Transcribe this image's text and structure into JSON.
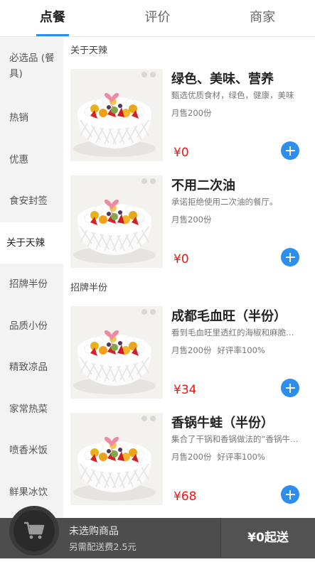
{
  "tabs": [
    "点餐",
    "评价",
    "商家"
  ],
  "sidebar": [
    "必选品 (餐具)",
    "热销",
    "优惠",
    "食安封签",
    "关于天辣",
    "招牌半份",
    "品质小份",
    "精致凉品",
    "家常热菜",
    "喷香米饭",
    "鲜果冰饮"
  ],
  "sections": [
    {
      "title": "关于天辣",
      "foods": [
        {
          "name": "绿色、美味、营养",
          "desc": "甄选优质食材，绿色，健康，美味",
          "sales": "月售200份",
          "rating": "",
          "price": "¥0"
        },
        {
          "name": "不用二次油",
          "desc": "承诺拒绝使用二次油的餐厅。",
          "sales": "月售200份",
          "rating": "",
          "price": "¥0"
        }
      ]
    },
    {
      "title": "招牌半份",
      "foods": [
        {
          "name": "成都毛血旺（半份）",
          "desc": "看到毛血旺里透红的海椒和麻脆的花生",
          "sales": "月售200份",
          "rating": "好评率100%",
          "price": "¥34"
        },
        {
          "name": "香锅牛蛙（半份）",
          "desc": "集合了干锅和香锅做法的“香锅牛蛙”",
          "sales": "月售200份",
          "rating": "好评率100%",
          "price": "¥68"
        }
      ]
    }
  ],
  "cart": {
    "status": "未选购商品",
    "delivery": "另需配送费2.5元",
    "checkout": "¥0起送"
  },
  "colors": {
    "accent": "#2b8ef0",
    "price": "#f01414",
    "cartbar": "#4d4d4d"
  },
  "icons": [
    "shopping-cart-icon",
    "plus-icon",
    "cake-image"
  ]
}
